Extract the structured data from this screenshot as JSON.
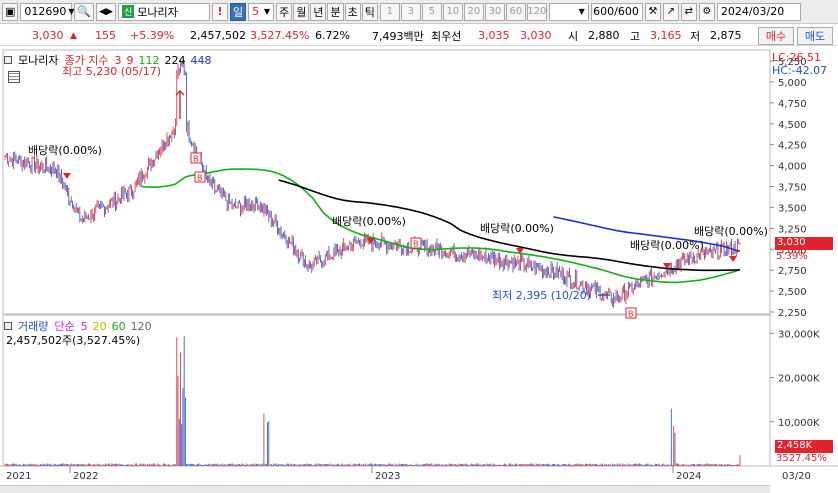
{
  "toolbar": {
    "code": "012690",
    "stock_name": "모나리자",
    "credit_badge": "신",
    "period_selected": "일",
    "period_value": "5",
    "periods": [
      "주",
      "월",
      "년",
      "분",
      "초",
      "틱"
    ],
    "intervals": [
      "1",
      "3",
      "5",
      "10",
      "20",
      "30",
      "60",
      "120"
    ],
    "bar_count": "600",
    "bar_total": "/600",
    "date": "2024/03/20"
  },
  "quote": {
    "price": "3,030",
    "change": "155",
    "change_pct": "+5.39%",
    "volume": "2,457,502",
    "volume_ratio": "3,527.45%",
    "turnover": "6.72%",
    "amount": "7,493백만",
    "best_ask_label": "최우선",
    "best_ask": "3,035",
    "best_bid": "3,030",
    "open_label": "시",
    "open": "2,880",
    "high_label": "고",
    "high": "3,165",
    "low_label": "저",
    "low": "2,875",
    "buy_label": "매수",
    "sell_label": "매도"
  },
  "price_pane": {
    "title": "모나리자",
    "legend_label": "종가 지수",
    "ma_values": [
      "3",
      "9",
      "112",
      "224",
      "448"
    ],
    "ma_colors": [
      "#e3232b",
      "#e3232b",
      "#12b012",
      "#000000",
      "#1e2fd0"
    ],
    "lc": "LC:26.51",
    "hc": "HC:-42.07",
    "high_annotation": "최고 5,230 (05/17)",
    "low_annotation": "최저 2,395 (10/20)",
    "dividend_labels": [
      "배당락(0.00%)",
      "배당락(0.00%)",
      "배당락(0.00%)",
      "배당락(0.00%)",
      "배당락(0.00%)"
    ],
    "current_price_tag": "3,030",
    "current_pct_tag": "5.39%"
  },
  "volume_pane": {
    "legend_label": "거래량",
    "legend_ma_label": "단순",
    "legend_ma_values": [
      "5",
      "20",
      "60",
      "120"
    ],
    "legend_ma_colors": [
      "#d020d0",
      "#b8b800",
      "#12b012",
      "#666666"
    ],
    "value_label": "2,457,502주(3,527.45%)",
    "current_volume_tag": "2,458K",
    "current_pct_tag": "3527.45%"
  },
  "x_axis": {
    "labels": [
      "2021",
      "2022",
      "2023",
      "2024",
      "03/20"
    ]
  },
  "chart_data": {
    "type": "candlestick",
    "price_axis": {
      "ticks": [
        "5,250",
        "5,000",
        "4,750",
        "4,500",
        "4,250",
        "4,000",
        "3,750",
        "3,500",
        "3,250",
        "3,000",
        "2,750",
        "2,500",
        "2,250"
      ],
      "ylim": [
        2250,
        5250
      ]
    },
    "volume_axis": {
      "ticks": [
        "30,000K",
        "20,000K",
        "10,000K"
      ],
      "ylim": [
        0,
        33000
      ]
    },
    "close_series": [
      {
        "x": "2021-10",
        "y": 4100
      },
      {
        "x": "2021-12",
        "y": 3950
      },
      {
        "x": "2022-01",
        "y": 3350
      },
      {
        "x": "2022-03",
        "y": 3700
      },
      {
        "x": "2022-05",
        "y": 4600
      },
      {
        "x": "2022-06",
        "y": 3800
      },
      {
        "x": "2022-07",
        "y": 3500
      },
      {
        "x": "2022-08",
        "y": 3550
      },
      {
        "x": "2022-10",
        "y": 2800
      },
      {
        "x": "2022-12",
        "y": 3100
      },
      {
        "x": "2023-03",
        "y": 3000
      },
      {
        "x": "2023-06",
        "y": 2850
      },
      {
        "x": "2023-08",
        "y": 2700
      },
      {
        "x": "2023-10",
        "y": 2400
      },
      {
        "x": "2023-12",
        "y": 2750
      },
      {
        "x": "2024-01",
        "y": 2900
      },
      {
        "x": "2024-03",
        "y": 3030
      }
    ]
  }
}
